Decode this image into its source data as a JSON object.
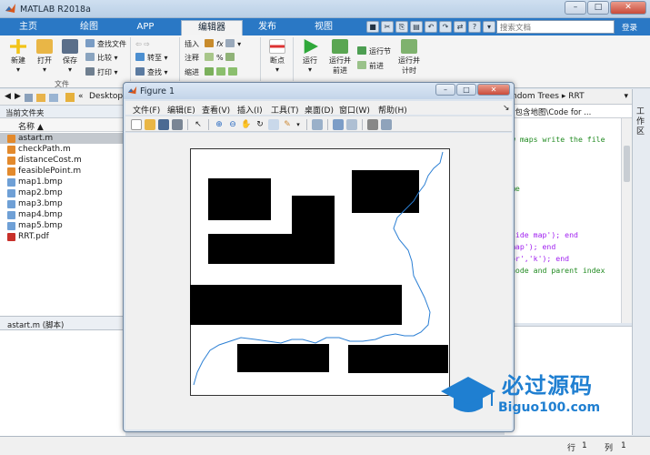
{
  "window": {
    "title": "MATLAB R2018a"
  },
  "main_tabs": [
    "主页",
    "绘图",
    "APP",
    "编辑器",
    "发布",
    "视图"
  ],
  "search": {
    "placeholder": "搜索文档"
  },
  "login_label": "登录",
  "ribbon": {
    "new": "新建",
    "open": "打开",
    "save": "保存",
    "find_files": "查找文件",
    "compare": "比较",
    "print": "打印",
    "goto": "转至",
    "find": "查找",
    "insert": "插入",
    "comment": "注释",
    "indent": "缩进",
    "breakpoints": "断点",
    "run": "运行",
    "run_advance": [
      "运行并",
      "前进"
    ],
    "run_section": "运行节",
    "advance": "前进",
    "run_time": [
      "运行并",
      "计时"
    ],
    "group_file": "文件"
  },
  "path": {
    "folder": "Desktop"
  },
  "current_folder": {
    "title": "当前文件夹",
    "col_name": "名称"
  },
  "files": [
    "astart.m",
    "checkPath.m",
    "distanceCost.m",
    "feasiblePoint.m",
    "map1.bmp",
    "map2.bmp",
    "map3.bmp",
    "map4.bmp",
    "map5.bmp",
    "RRT.pdf"
  ],
  "details": {
    "label": "astart.m (脚本)"
  },
  "editor": {
    "breadcrumb": "ndom Trees ▸ RRT",
    "file_path": "内包含地图\\Code for ...",
    "lines": [
      {
        "text": "w maps write the file",
        "color": "#228b22"
      },
      {
        "text": "me",
        "color": "#228b22"
      },
      {
        "text": "side map'); end",
        "color": "#a020f0"
      },
      {
        "text": " map'); end",
        "color": "#a020f0"
      },
      {
        "text": "or','k'); end",
        "color": "#a020f0"
      },
      {
        "text": "node and parent index",
        "color": "#228b22"
      }
    ]
  },
  "workspace_tab": "工作区",
  "status": {
    "row_label": "行",
    "row": "1",
    "col_label": "列",
    "col": "1"
  },
  "watermark": {
    "text": "必过源码",
    "url": "Biguo100.com"
  },
  "figure": {
    "title": "Figure 1",
    "menu": [
      "文件(F)",
      "编辑(E)",
      "查看(V)",
      "插入(I)",
      "工具(T)",
      "桌面(D)",
      "窗口(W)",
      "帮助(H)"
    ]
  }
}
